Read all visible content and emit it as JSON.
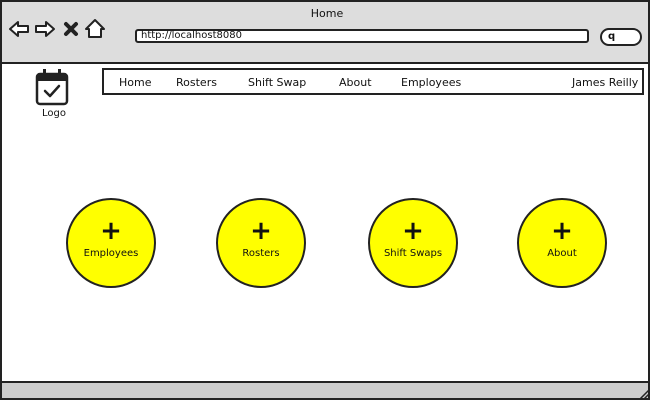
{
  "window": {
    "title": "Home"
  },
  "browser": {
    "url": "http://localhost8080",
    "back_icon": "arrow-left-icon",
    "forward_icon": "arrow-right-icon",
    "close_icon": "x-icon",
    "home_icon": "home-icon",
    "search_icon": "search-icon"
  },
  "logo": {
    "label": "Logo",
    "icon": "calendar-check-icon"
  },
  "nav": {
    "items": [
      {
        "label": "Home"
      },
      {
        "label": "Rosters"
      },
      {
        "label": "Shift Swap"
      },
      {
        "label": "About"
      },
      {
        "label": "Employees"
      }
    ],
    "user": "James Reilly"
  },
  "actions": [
    {
      "label": "Employees",
      "symbol": "+"
    },
    {
      "label": "Rosters",
      "symbol": "+"
    },
    {
      "label": "Shift Swaps",
      "symbol": "+"
    },
    {
      "label": "About",
      "symbol": "+"
    }
  ],
  "colors": {
    "button_fill": "#ffff00",
    "chrome": "#dddddd",
    "outline": "#222222"
  }
}
